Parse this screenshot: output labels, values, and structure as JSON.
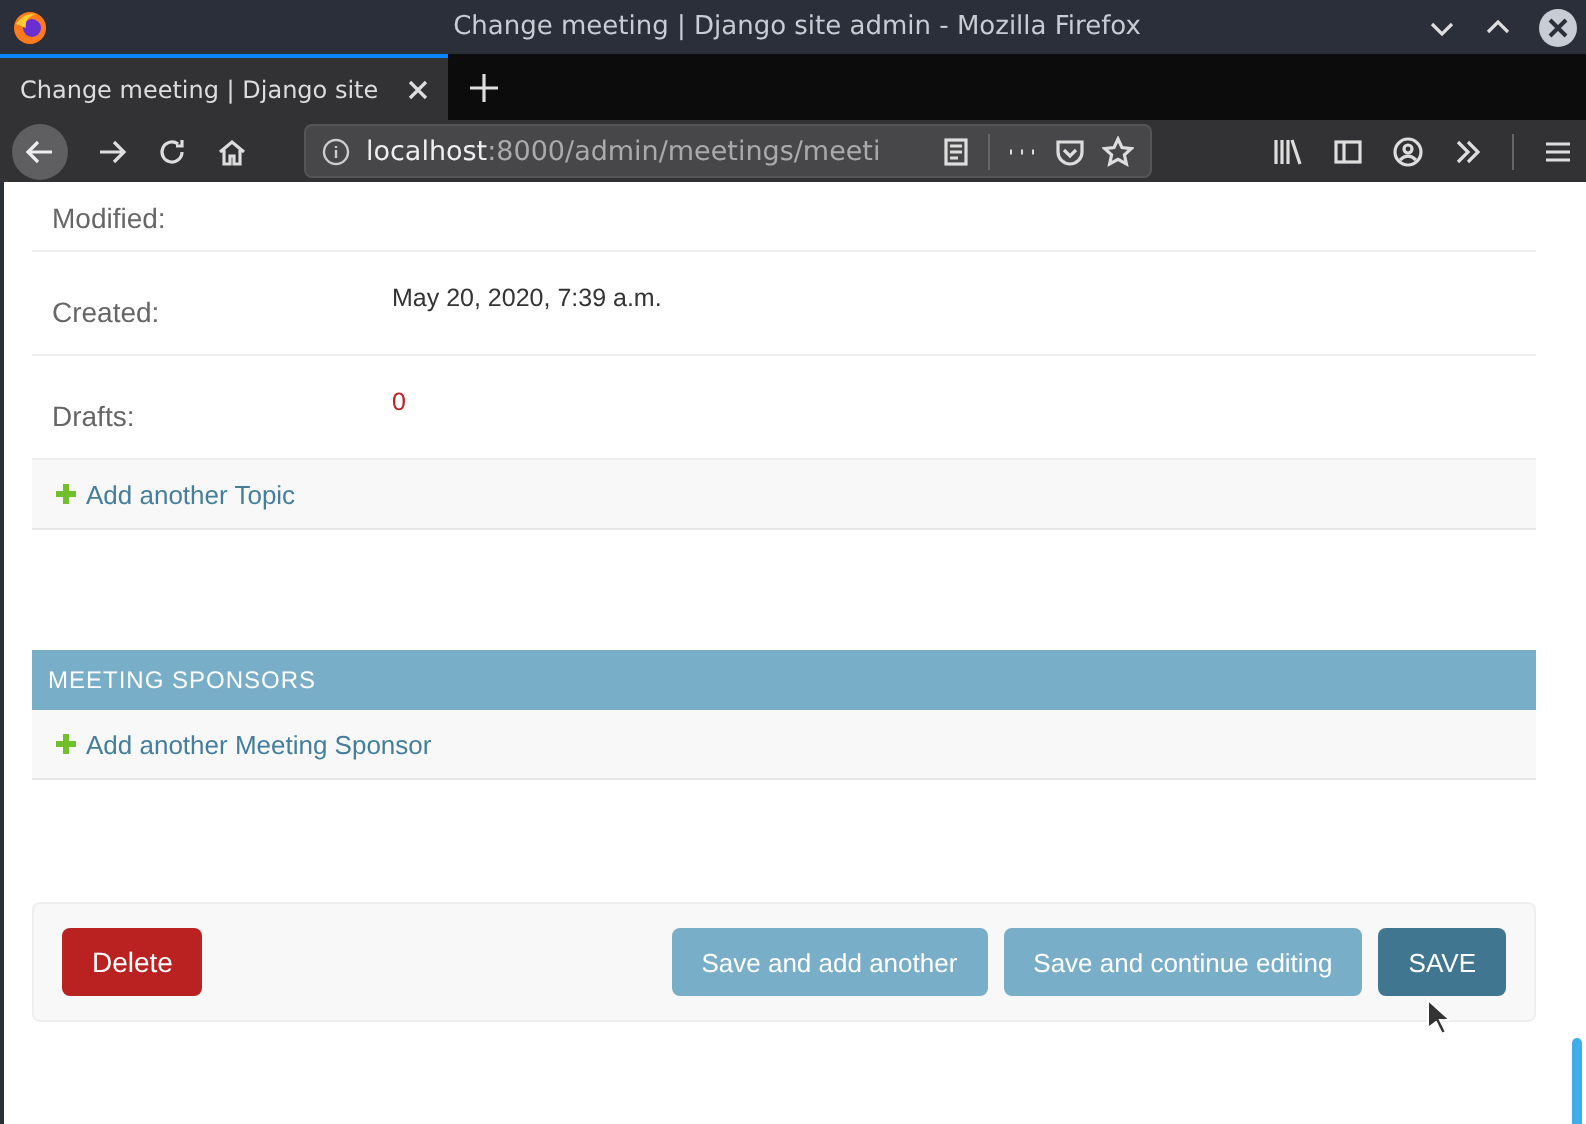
{
  "window": {
    "title": "Change meeting | Django site admin - Mozilla Firefox"
  },
  "tabs": [
    {
      "label": "Change meeting | Django site",
      "selected": true
    }
  ],
  "address_bar": {
    "host": "localhost",
    "path": ":8000/admin/meetings/meeti"
  },
  "fields": [
    {
      "label": "Modified:",
      "kind": "text"
    },
    {
      "label": "Created:",
      "value": "May 20, 2020, 7:39 a.m.",
      "kind": "text"
    },
    {
      "label": "Drafts:",
      "value": "0",
      "kind": "count"
    }
  ],
  "topics": {
    "add_link": "Add another Topic"
  },
  "sponsors": {
    "title": "MEETING SPONSORS",
    "add_link": "Add another Meeting Sponsor"
  },
  "actions": {
    "delete": "Delete",
    "buttons": [
      {
        "label": "Save and add another",
        "kind": "secondary"
      },
      {
        "label": "Save and continue editing",
        "kind": "secondary"
      },
      {
        "label": "SAVE",
        "kind": "default"
      }
    ]
  }
}
